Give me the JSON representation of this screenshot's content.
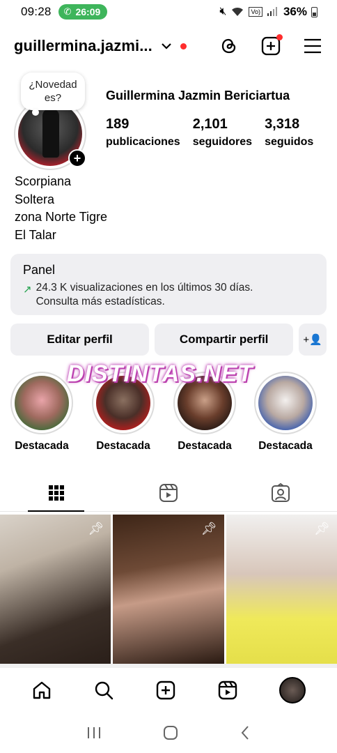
{
  "status_bar": {
    "time": "09:28",
    "call_timer": "26:09",
    "battery_percent": "36%"
  },
  "header": {
    "username": "guillermina.jazmi...",
    "chevron_icon": "chevron-down-icon",
    "icons": [
      "threads-icon",
      "create-post-icon",
      "menu-icon"
    ]
  },
  "profile": {
    "story_bubble": "¿Novedad es?",
    "full_name": "Guillermina Jazmin Bericiartua",
    "stats": [
      {
        "value": "189",
        "label": "publicaciones"
      },
      {
        "value": "2,101",
        "label": "seguidores"
      },
      {
        "value": "3,318",
        "label": "seguidos"
      }
    ],
    "bio_lines": [
      "Scorpiana",
      "Soltera",
      "zona Norte Tigre",
      "El Talar"
    ]
  },
  "panel": {
    "title": "Panel",
    "line1": "24.3 K visualizaciones en los últimos 30 días.",
    "line2": "Consulta más estadísticas."
  },
  "actions": {
    "edit_profile": "Editar perfil",
    "share_profile": "Compartir perfil",
    "add_person_icon": "+👤"
  },
  "watermark": "DISTINTAS.NET",
  "highlights": [
    {
      "label": "Destacada"
    },
    {
      "label": "Destacada"
    },
    {
      "label": "Destacada"
    },
    {
      "label": "Destacada"
    }
  ],
  "tabs": [
    "grid-icon",
    "reels-icon",
    "tagged-icon"
  ],
  "bottom_nav": [
    "home-icon",
    "search-icon",
    "create-icon",
    "reels-icon",
    "profile-avatar"
  ],
  "colors": {
    "call_pill": "#3eb55b",
    "notification_dot": "#ff2d2d",
    "panel_bg": "#efeff2",
    "trend_arrow": "#1fa04a"
  }
}
